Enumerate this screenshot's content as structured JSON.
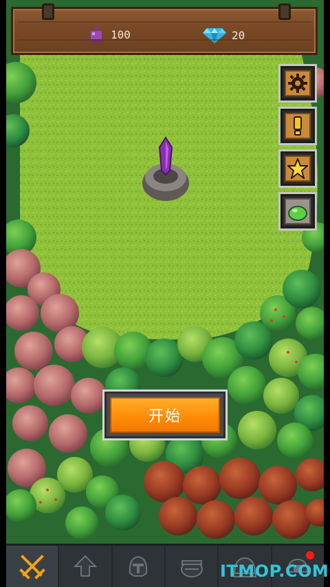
{
  "resources": {
    "potion_count": "100",
    "gem_count": "20"
  },
  "side_buttons": [
    {
      "icon": "gear-icon"
    },
    {
      "icon": "exclamation-icon"
    },
    {
      "icon": "star-icon"
    },
    {
      "icon": "slime-icon"
    }
  ],
  "start_button": {
    "label": "开始"
  },
  "bottom_nav": [
    {
      "icon": "crossed-swords-icon",
      "active": true
    },
    {
      "icon": "upgrade-arrow-icon"
    },
    {
      "icon": "helmet-icon"
    },
    {
      "icon": "cauldron-icon"
    },
    {
      "icon": "dome-icon"
    },
    {
      "icon": "shop-icon",
      "notification": true
    }
  ],
  "watermark": "ITMOP.COM",
  "colors": {
    "grass": "#8fc13a",
    "start_button": "#ff9a10",
    "wood": "#7a4a27",
    "bar": "#2d3337",
    "watermark": "#35c3d8"
  }
}
